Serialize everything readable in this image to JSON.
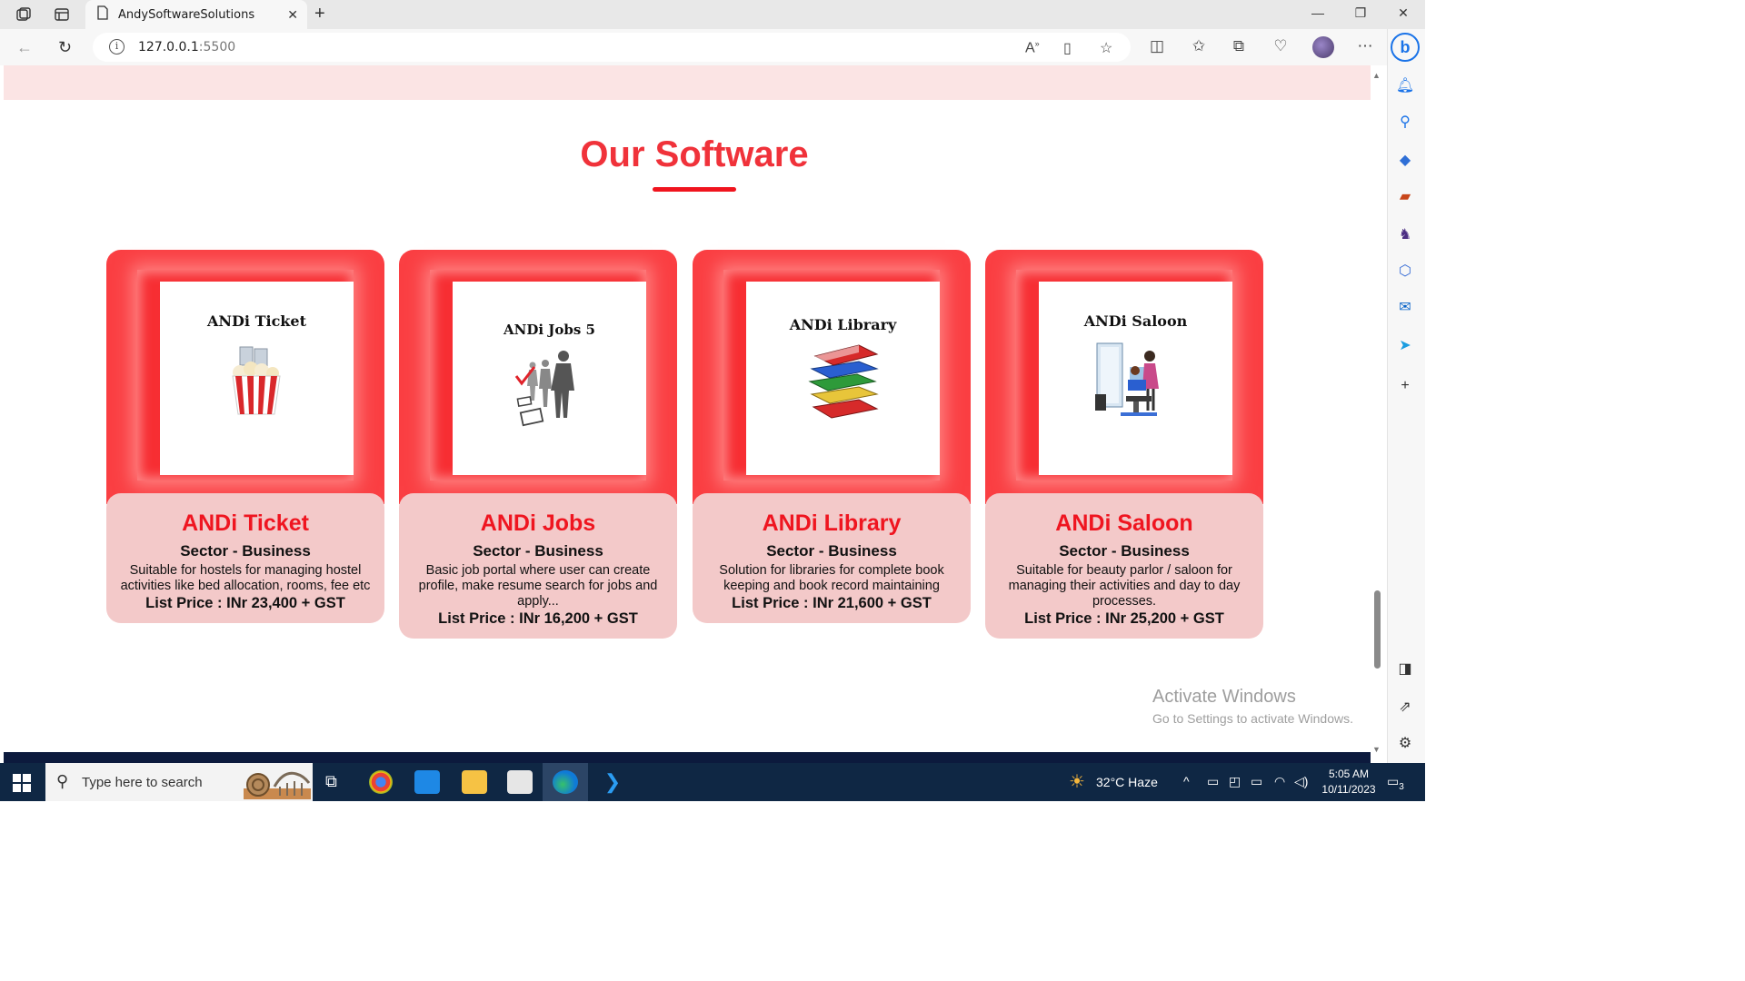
{
  "browser": {
    "tab_title": "AndySoftwareSolutions",
    "url_host": "127.0.0.1",
    "url_port": ":5500"
  },
  "page": {
    "section_title": "Our Software",
    "cards": [
      {
        "image_label": "ANDi Ticket",
        "name": "ANDi Ticket",
        "sector": "Sector - Business",
        "description": "Suitable for hostels for managing hostel activities like bed allocation, rooms, fee etc",
        "price": "List Price : INr 23,400 + GST"
      },
      {
        "image_label": "ANDi Jobs 5",
        "name": "ANDi Jobs",
        "sector": "Sector - Business",
        "description": "Basic job portal where user can create profile, make resume search for jobs and apply...",
        "price": "List Price : INr 16,200 + GST"
      },
      {
        "image_label": "ANDi Library",
        "name": "ANDi Library",
        "sector": "Sector - Business",
        "description": "Solution for libraries for complete book keeping and book record maintaining",
        "price": "List Price : INr 21,600 + GST"
      },
      {
        "image_label": "ANDi Saloon",
        "name": "ANDi Saloon",
        "sector": "Sector - Business",
        "description": "Suitable for beauty parlor / saloon for managing their activities and day to day processes.",
        "price": "List Price : INr 25,200 + GST"
      }
    ]
  },
  "watermark": {
    "line1": "Activate Windows",
    "line2": "Go to Settings to activate Windows."
  },
  "taskbar": {
    "search_placeholder": "Type here to search",
    "weather": "32°C  Haze",
    "time": "5:05 AM",
    "date": "10/11/2023",
    "notification_count": "3"
  },
  "colors": {
    "accent_red": "#f0323a",
    "card_red": "#fa3f43",
    "card_body": "#f3c9c9",
    "footer_navy": "#0c1a3d"
  }
}
